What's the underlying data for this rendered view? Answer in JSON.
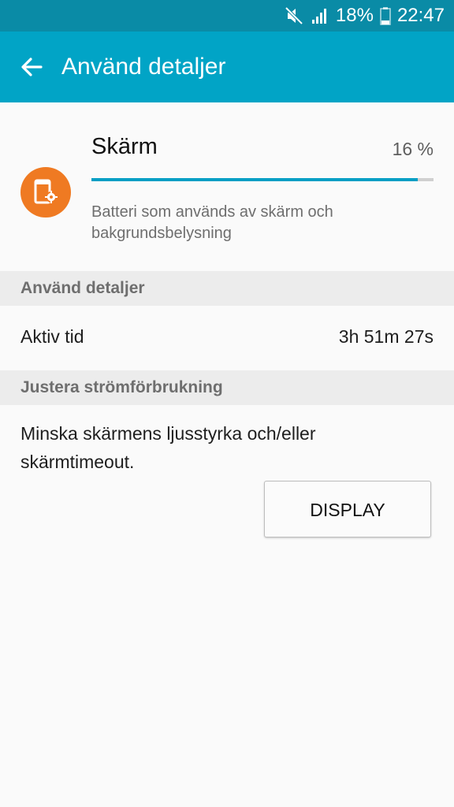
{
  "status_bar": {
    "battery_percent": "18%",
    "time": "22:47",
    "icons": [
      "mute-icon",
      "signal-icon",
      "battery-icon"
    ]
  },
  "app_bar": {
    "title": "Använd detaljer",
    "back_icon": "back-arrow-icon"
  },
  "usage": {
    "name": "Skärm",
    "percent_label": "16 %",
    "progress_fraction": 0.955,
    "description": "Batteri som används av skärm och bakgrundsbelysning",
    "icon": "screen-settings-icon",
    "icon_color": "#ef7a22",
    "progress_color": "#069ec4"
  },
  "details_section": {
    "header": "Använd detaljer",
    "active_time_label": "Aktiv tid",
    "active_time_value": "3h 51m 27s"
  },
  "adjust_section": {
    "header": "Justera strömförbrukning",
    "tip": "Minska skärmens ljusstyrka och/eller skärmtimeout.",
    "button_label": "DISPLAY"
  },
  "colors": {
    "status_bar": "#0a8ba6",
    "app_bar": "#01a4c6",
    "background": "#fafafa",
    "section_header": "#ececec"
  }
}
